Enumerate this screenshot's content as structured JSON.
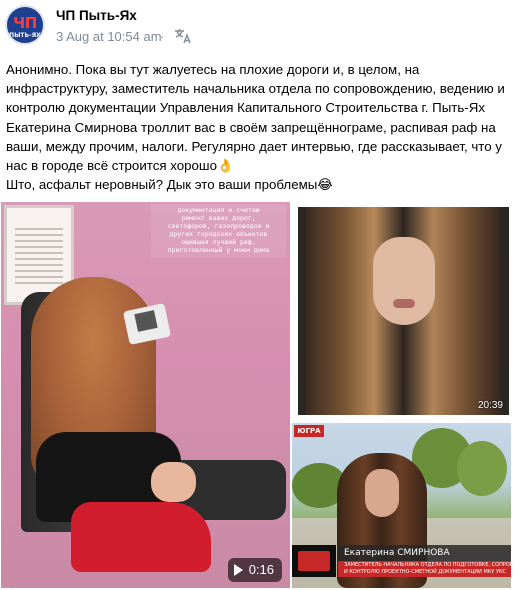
{
  "header": {
    "group_name": "ЧП Пыть-Ях",
    "timestamp": "3 Aug at 10:54 am",
    "separator": "·",
    "avatar_top": "ЧП",
    "avatar_bottom": "ПЫТЬ-ЯХ",
    "translate_icon": "translate-icon"
  },
  "post": {
    "lines": [
      "Анонимно. Пока вы тут жалуетесь на плохие дороги и, в целом, на",
      "инфраструктуру, заместитель начальника отдела по сопровождению, ведению и",
      "контролю документации Управления Капитального Строительства г. Пыть-Ях",
      "Екатерина Смирнова троллит вас в своём запрещённограме, распивая раф на",
      "ваши, между прочим, налоги. Регулярно дает интервью, где рассказывает, что у",
      "нас в городе всё строится хорошо👌",
      "Што, асфальт неровный? Дык это ваши проблемы😂"
    ]
  },
  "media": {
    "video": {
      "duration": "0:16",
      "caption_lines": [
        "документация и считаю",
        "ремонт ваших дорог,",
        "светофоров, газопроводов и",
        "других городских объектов",
        "ощившая лучший раф,",
        "приготовленный у моем дома"
      ]
    },
    "photo": {
      "badge": "20:39"
    },
    "tv_still": {
      "channel_logo": "ЮГРА",
      "name": "Екатерина СМИРНОВА",
      "title_line1": "ЗАМЕСТИТЕЛЬ НАЧАЛЬНИКА ОТДЕЛА ПО ПОДГОТОВКЕ, СОПРОВОЖДЕНИЮ",
      "title_line2": "И КОНТРОЛЮ ПРОЕКТНО-СМЕТНОЙ ДОКУМЕНТАЦИИ МКУ УКС"
    }
  }
}
